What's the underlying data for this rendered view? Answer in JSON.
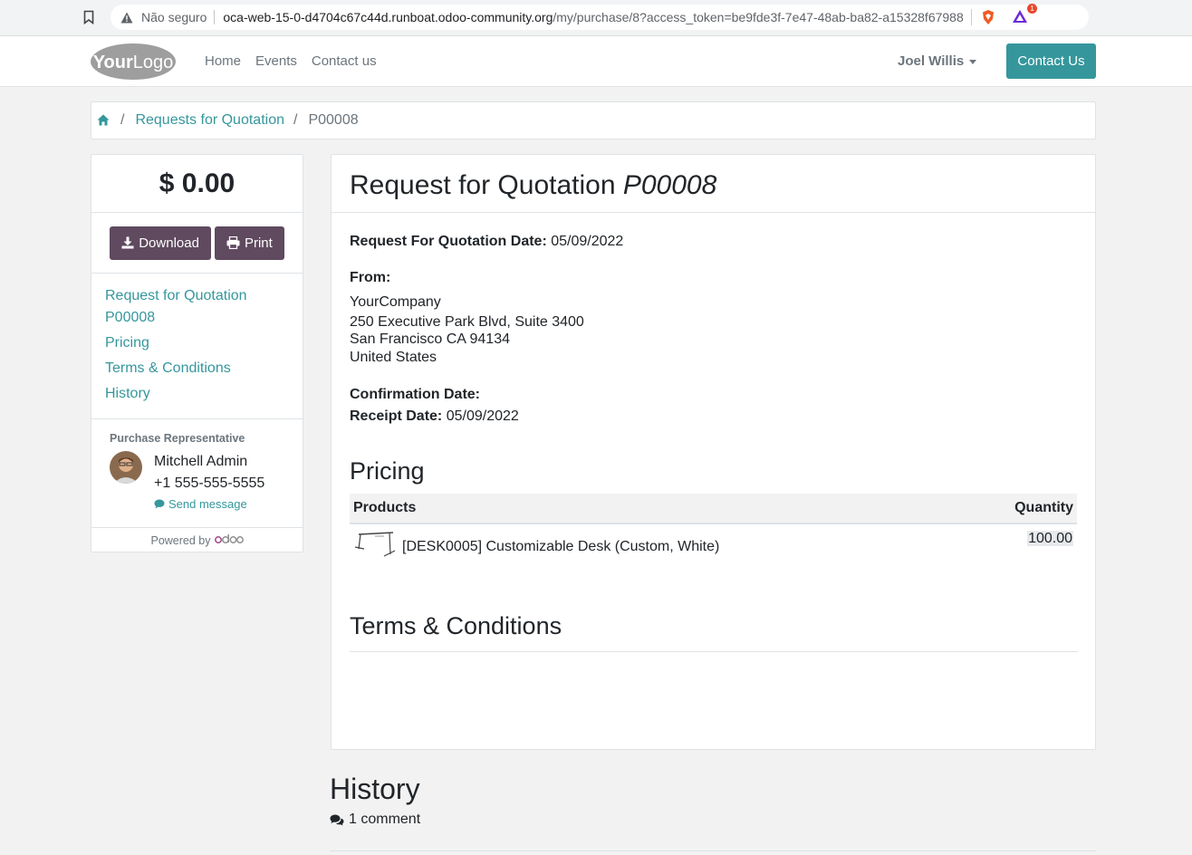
{
  "browser": {
    "security_label": "Não seguro",
    "url_host": "oca-web-15-0-d4704c67c44d.runboat.odoo-community.org",
    "url_path": "/my/purchase/8?access_token=be9fde3f-7e47-48ab-ba82-a15328f67988",
    "rewards_badge": "1"
  },
  "navbar": {
    "logo_text": "YourLogo",
    "links": [
      "Home",
      "Events",
      "Contact us"
    ],
    "user": "Joel Willis",
    "contact_button": "Contact Us"
  },
  "breadcrumb": {
    "link": "Requests for Quotation",
    "active": "P00008",
    "separator": "/"
  },
  "sidebar": {
    "total": "$ 0.00",
    "download_label": "Download",
    "print_label": "Print",
    "toc": [
      "Request for Quotation P00008",
      "Pricing",
      "Terms & Conditions",
      "History"
    ],
    "rep_title": "Purchase Representative",
    "rep_name": "Mitchell Admin",
    "rep_phone": "+1 555-555-5555",
    "send_message": "Send message",
    "powered_by": "Powered by",
    "odoo": "odoo"
  },
  "main": {
    "title_prefix": "Request for Quotation",
    "title_ref": "P00008",
    "rfq_date_label": "Request For Quotation Date:",
    "rfq_date": "05/09/2022",
    "from_label": "From:",
    "company": "YourCompany",
    "address_line1": "250 Executive Park Blvd, Suite 3400",
    "address_line2": "San Francisco CA 94134",
    "address_line3": "United States",
    "confirmation_label": "Confirmation Date:",
    "receipt_label": "Receipt Date:",
    "receipt_date": "05/09/2022",
    "pricing_title": "Pricing",
    "col_products": "Products",
    "col_quantity": "Quantity",
    "product": "[DESK0005] Customizable Desk (Custom, White)",
    "quantity": "100.00",
    "terms_title": "Terms & Conditions"
  },
  "history": {
    "title": "History",
    "comments": "1 comment"
  },
  "colors": {
    "accent": "#35979c",
    "button": "#5f4a5f"
  }
}
